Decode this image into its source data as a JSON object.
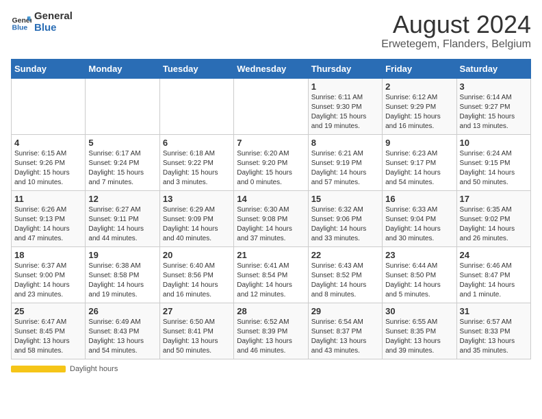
{
  "header": {
    "logo_general": "General",
    "logo_blue": "Blue",
    "title": "August 2024",
    "subtitle": "Erwetegem, Flanders, Belgium"
  },
  "days_of_week": [
    "Sunday",
    "Monday",
    "Tuesday",
    "Wednesday",
    "Thursday",
    "Friday",
    "Saturday"
  ],
  "weeks": [
    [
      {
        "day": "",
        "info": ""
      },
      {
        "day": "",
        "info": ""
      },
      {
        "day": "",
        "info": ""
      },
      {
        "day": "",
        "info": ""
      },
      {
        "day": "1",
        "info": "Sunrise: 6:11 AM\nSunset: 9:30 PM\nDaylight: 15 hours\nand 19 minutes."
      },
      {
        "day": "2",
        "info": "Sunrise: 6:12 AM\nSunset: 9:29 PM\nDaylight: 15 hours\nand 16 minutes."
      },
      {
        "day": "3",
        "info": "Sunrise: 6:14 AM\nSunset: 9:27 PM\nDaylight: 15 hours\nand 13 minutes."
      }
    ],
    [
      {
        "day": "4",
        "info": "Sunrise: 6:15 AM\nSunset: 9:26 PM\nDaylight: 15 hours\nand 10 minutes."
      },
      {
        "day": "5",
        "info": "Sunrise: 6:17 AM\nSunset: 9:24 PM\nDaylight: 15 hours\nand 7 minutes."
      },
      {
        "day": "6",
        "info": "Sunrise: 6:18 AM\nSunset: 9:22 PM\nDaylight: 15 hours\nand 3 minutes."
      },
      {
        "day": "7",
        "info": "Sunrise: 6:20 AM\nSunset: 9:20 PM\nDaylight: 15 hours\nand 0 minutes."
      },
      {
        "day": "8",
        "info": "Sunrise: 6:21 AM\nSunset: 9:19 PM\nDaylight: 14 hours\nand 57 minutes."
      },
      {
        "day": "9",
        "info": "Sunrise: 6:23 AM\nSunset: 9:17 PM\nDaylight: 14 hours\nand 54 minutes."
      },
      {
        "day": "10",
        "info": "Sunrise: 6:24 AM\nSunset: 9:15 PM\nDaylight: 14 hours\nand 50 minutes."
      }
    ],
    [
      {
        "day": "11",
        "info": "Sunrise: 6:26 AM\nSunset: 9:13 PM\nDaylight: 14 hours\nand 47 minutes."
      },
      {
        "day": "12",
        "info": "Sunrise: 6:27 AM\nSunset: 9:11 PM\nDaylight: 14 hours\nand 44 minutes."
      },
      {
        "day": "13",
        "info": "Sunrise: 6:29 AM\nSunset: 9:09 PM\nDaylight: 14 hours\nand 40 minutes."
      },
      {
        "day": "14",
        "info": "Sunrise: 6:30 AM\nSunset: 9:08 PM\nDaylight: 14 hours\nand 37 minutes."
      },
      {
        "day": "15",
        "info": "Sunrise: 6:32 AM\nSunset: 9:06 PM\nDaylight: 14 hours\nand 33 minutes."
      },
      {
        "day": "16",
        "info": "Sunrise: 6:33 AM\nSunset: 9:04 PM\nDaylight: 14 hours\nand 30 minutes."
      },
      {
        "day": "17",
        "info": "Sunrise: 6:35 AM\nSunset: 9:02 PM\nDaylight: 14 hours\nand 26 minutes."
      }
    ],
    [
      {
        "day": "18",
        "info": "Sunrise: 6:37 AM\nSunset: 9:00 PM\nDaylight: 14 hours\nand 23 minutes."
      },
      {
        "day": "19",
        "info": "Sunrise: 6:38 AM\nSunset: 8:58 PM\nDaylight: 14 hours\nand 19 minutes."
      },
      {
        "day": "20",
        "info": "Sunrise: 6:40 AM\nSunset: 8:56 PM\nDaylight: 14 hours\nand 16 minutes."
      },
      {
        "day": "21",
        "info": "Sunrise: 6:41 AM\nSunset: 8:54 PM\nDaylight: 14 hours\nand 12 minutes."
      },
      {
        "day": "22",
        "info": "Sunrise: 6:43 AM\nSunset: 8:52 PM\nDaylight: 14 hours\nand 8 minutes."
      },
      {
        "day": "23",
        "info": "Sunrise: 6:44 AM\nSunset: 8:50 PM\nDaylight: 14 hours\nand 5 minutes."
      },
      {
        "day": "24",
        "info": "Sunrise: 6:46 AM\nSunset: 8:47 PM\nDaylight: 14 hours\nand 1 minute."
      }
    ],
    [
      {
        "day": "25",
        "info": "Sunrise: 6:47 AM\nSunset: 8:45 PM\nDaylight: 13 hours\nand 58 minutes."
      },
      {
        "day": "26",
        "info": "Sunrise: 6:49 AM\nSunset: 8:43 PM\nDaylight: 13 hours\nand 54 minutes."
      },
      {
        "day": "27",
        "info": "Sunrise: 6:50 AM\nSunset: 8:41 PM\nDaylight: 13 hours\nand 50 minutes."
      },
      {
        "day": "28",
        "info": "Sunrise: 6:52 AM\nSunset: 8:39 PM\nDaylight: 13 hours\nand 46 minutes."
      },
      {
        "day": "29",
        "info": "Sunrise: 6:54 AM\nSunset: 8:37 PM\nDaylight: 13 hours\nand 43 minutes."
      },
      {
        "day": "30",
        "info": "Sunrise: 6:55 AM\nSunset: 8:35 PM\nDaylight: 13 hours\nand 39 minutes."
      },
      {
        "day": "31",
        "info": "Sunrise: 6:57 AM\nSunset: 8:33 PM\nDaylight: 13 hours\nand 35 minutes."
      }
    ]
  ],
  "footer": {
    "daylight_label": "Daylight hours"
  }
}
